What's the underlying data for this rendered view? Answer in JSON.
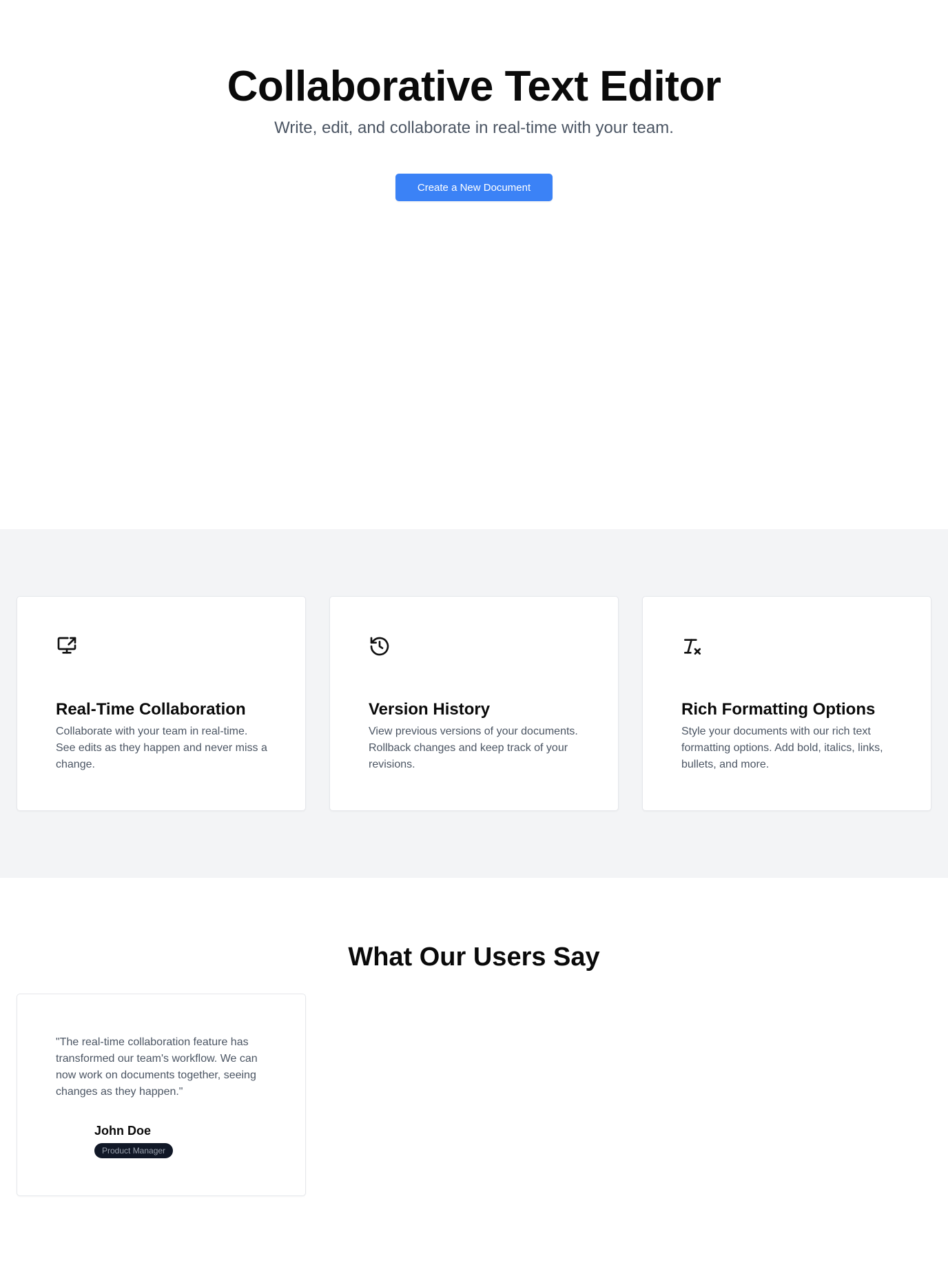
{
  "hero": {
    "title": "Collaborative Text Editor",
    "subtitle": "Write, edit, and collaborate in real-time with your team.",
    "cta_label": "Create a New Document"
  },
  "features": [
    {
      "icon": "monitor-share-icon",
      "title": "Real-Time Collaboration",
      "description": "Collaborate with your team in real-time. See edits as they happen and never miss a change."
    },
    {
      "icon": "history-icon",
      "title": "Version History",
      "description": "View previous versions of your documents. Rollback changes and keep track of your revisions."
    },
    {
      "icon": "clear-formatting-icon",
      "title": "Rich Formatting Options",
      "description": "Style your documents with our rich text formatting options. Add bold, italics, links, bullets, and more."
    }
  ],
  "testimonials": {
    "title": "What Our Users Say",
    "items": [
      {
        "quote": "\"The real-time collaboration feature has transformed our team's workflow. We can now work on documents together, seeing changes as they happen.\"",
        "name": "John Doe",
        "role": "Product Manager"
      }
    ]
  },
  "colors": {
    "accent": "#3b82f6",
    "features_background": "#f3f4f6",
    "body_text": "#4b5563",
    "badge_background": "#111827"
  }
}
